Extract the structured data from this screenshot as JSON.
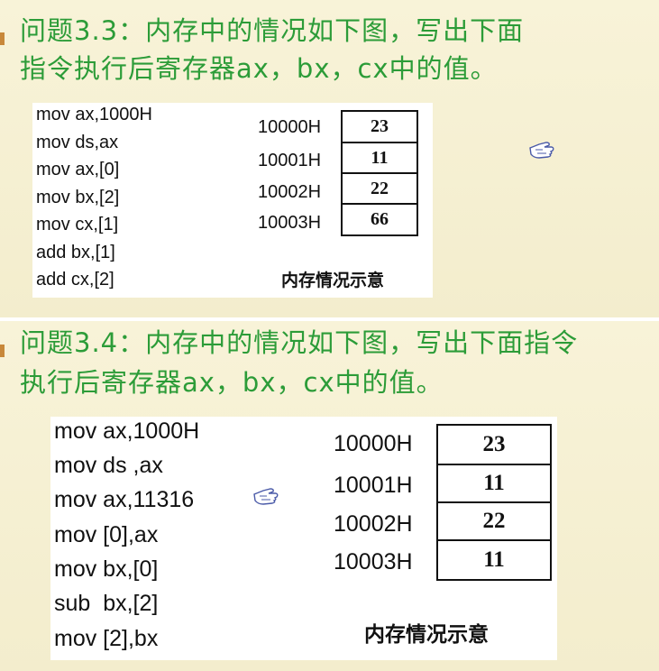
{
  "q1": {
    "line1": "问题3.3：内存中的情况如下图，写出下面",
    "line2": "指令执行后寄存器ax，bx，cx中的值。",
    "code": [
      "mov ax,1000H",
      "mov ds,ax",
      "mov ax,[0]",
      "mov bx,[2]",
      "mov cx,[1]",
      "add bx,[1]",
      "add cx,[2]"
    ],
    "memory": [
      {
        "addr": "10000H",
        "val": "23"
      },
      {
        "addr": "10001H",
        "val": "11"
      },
      {
        "addr": "10002H",
        "val": "22"
      },
      {
        "addr": "10003H",
        "val": "66"
      }
    ],
    "caption": "内存情况示意"
  },
  "q2": {
    "line1": "问题3.4：内存中的情况如下图，写出下面指令",
    "line2": "执行后寄存器ax，bx，cx中的值。",
    "code": [
      "mov ax,1000H",
      "mov ds ,ax",
      "mov ax,11316",
      "mov [0],ax",
      "mov bx,[0]",
      "sub  bx,[2]",
      "mov [2],bx"
    ],
    "memory": [
      {
        "addr": "10000H",
        "val": "23"
      },
      {
        "addr": "10001H",
        "val": "11"
      },
      {
        "addr": "10002H",
        "val": "22"
      },
      {
        "addr": "10003H",
        "val": "11"
      }
    ],
    "caption": "内存情况示意"
  },
  "icons": {
    "cursor": "pointing-hand-icon"
  },
  "colors": {
    "question_text": "#2c9c38",
    "background": "#f7f2d6",
    "bullet": "#c8883a"
  }
}
